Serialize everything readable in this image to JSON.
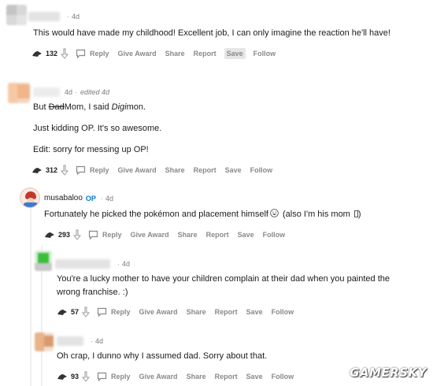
{
  "comments": [
    {
      "time": "4d",
      "text": "This would have made my childhood! Excellent job, I can only imagine the reaction he'll have!",
      "votes": "132",
      "actions": [
        "Reply",
        "Give Award",
        "Share",
        "Report",
        "Save",
        "Follow"
      ]
    },
    {
      "time": "4d",
      "edited": "edited 4d",
      "para1_prefix": "But ",
      "para1_struck": "Dad",
      "para1_mid": "Mom, I said ",
      "para1_italic": "Digi",
      "para1_suffix": "mon.",
      "para2": "Just kidding OP. It's so awesome.",
      "para3": "Edit: sorry for messing up OP!",
      "votes": "312",
      "actions": [
        "Reply",
        "Give Award",
        "Share",
        "Report",
        "Save",
        "Follow"
      ]
    },
    {
      "username": "musabaloo",
      "op_badge": "OP",
      "time": "4d",
      "text_before_emoji": "Fortunately he picked the pokémon and placement himself",
      "text_after_emoji": " (also I'm his mom ",
      "text_end": ")",
      "votes": "293",
      "actions": [
        "Reply",
        "Give Award",
        "Share",
        "Report",
        "Save",
        "Follow"
      ]
    },
    {
      "time": "4d",
      "text": "You're a lucky mother to have your children complain at their dad when you painted the wrong franchise. :)",
      "votes": "57",
      "actions": [
        "Reply",
        "Give Award",
        "Share",
        "Report",
        "Save",
        "Follow"
      ]
    },
    {
      "time": "4d",
      "text": "Oh crap, I dunno why I assumed dad. Sorry about that.",
      "votes": "93",
      "actions": [
        "Reply",
        "Give Award",
        "Share",
        "Report",
        "Save",
        "Follow"
      ]
    }
  ],
  "highlighted_action": "Save",
  "icons": {
    "upvote": "upvote-icon",
    "downvote": "downvote-icon",
    "reply": "comment-bubble-icon",
    "emoji": "grin-emoji-icon"
  },
  "colors": {
    "accent": "#0079d3",
    "meta": "#7c7c7c",
    "action": "#878a8c"
  }
}
